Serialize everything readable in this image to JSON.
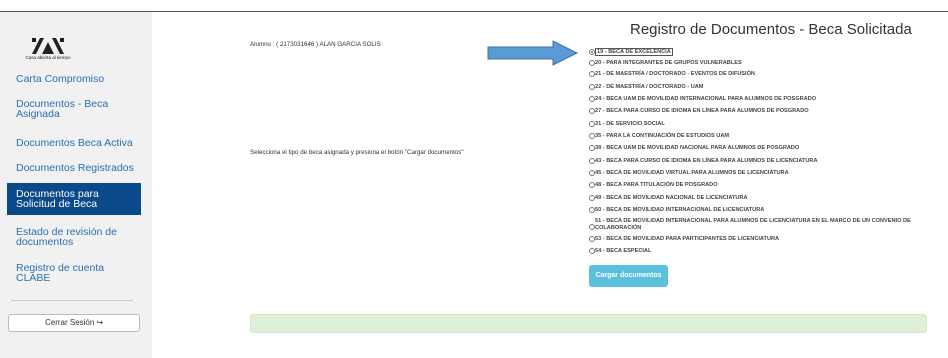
{
  "logo": {
    "caption": "Casa abierta al tiempo",
    "name": "UAM"
  },
  "sidebar": {
    "items": [
      {
        "label": "Carta Compromiso"
      },
      {
        "label": "Documentos - Beca Asignada"
      },
      {
        "label": "Documentos Beca Activa"
      },
      {
        "label": "Documentos Registrados"
      },
      {
        "label": "Documentos para Solicitud de Beca",
        "active": true
      },
      {
        "label": "Estado de revisión de documentos"
      },
      {
        "label": "Registro de cuenta CLABE"
      }
    ],
    "logout_label": "Cerrar Sesión",
    "logout_icon": "sign-out-icon"
  },
  "main": {
    "student": "Alumno : ( 2173031646 ) ALAN GARCIA SOLIS",
    "instruction": "Selecciona el tipo de beca asignada y presiona el botón \"Cargar documentos\"",
    "title": "Registro de Documentos - Beca Solicitada",
    "options": [
      {
        "label": "19 - BECA DE EXCELENCIA",
        "selected": true
      },
      {
        "label": "20 - PARA INTEGRANTES DE GRUPOS VULNERABLES"
      },
      {
        "label": "21 - DE MAESTRÍA / DOCTORADO - EVENTOS DE DIFUSIÓN"
      },
      {
        "label": "22 - DE MAESTRÍA / DOCTORADO - UAM"
      },
      {
        "label": "24 - BECA UAM DE MOVILIDAD INTERNACIONAL PARA ALUMNOS DE POSGRADO"
      },
      {
        "label": "27 - BECA PARA CURSO DE IDIOMA EN LÍNEA PARA ALUMNOS DE POSGRADO"
      },
      {
        "label": "31 - DE SERVICIO SOCIAL"
      },
      {
        "label": "35 - PARA LA CONTINUACIÓN DE ESTUDIOS UAM"
      },
      {
        "label": "38 - BECA UAM DE MOVILIDAD NACIONAL PARA ALUMNOS DE POSGRADO"
      },
      {
        "label": "43 - BECA PARA CURSO DE IDIOMA EN LÍNEA PARA ALUMNOS DE LICENCIATURA"
      },
      {
        "label": "45 - BECA DE MOVILIDAD VIRTUAL PARA ALUMNOS DE LICENCIATURA"
      },
      {
        "label": "48 - BECA PARA TITULACIÓN DE POSGRADO"
      },
      {
        "label": "49 - BECA DE MOVILIDAD NACIONAL DE LICENCIATURA"
      },
      {
        "label": "50 - BECA DE MOVILIDAD INTERNACIONAL DE LICENCIATURA"
      },
      {
        "label": "51 - BECA DE MOVILIDAD INTERNACIONAL PARA ALUMNOS DE LICENCIATURA EN EL MARCO DE UN CONVENIO DE COLABORACIÓN"
      },
      {
        "label": "53 - BECA DE MOVILIDAD PARA PARTICIPANTES DE LICENCIATURA"
      },
      {
        "label": "54 - BECA ESPECIAL"
      }
    ],
    "upload_label": "Cargar documentos"
  },
  "colors": {
    "accent": "#0a4a8a",
    "link": "#2a6fb0",
    "button": "#5bc0de",
    "alert": "#dff0d8",
    "arrow": "#5b9bd5"
  }
}
